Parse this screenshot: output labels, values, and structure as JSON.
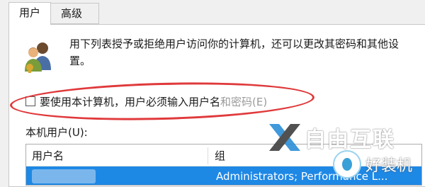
{
  "tabs": [
    {
      "label": "用户"
    },
    {
      "label": "高级"
    }
  ],
  "description": "用下列表授予或拒绝用户访问你的计算机，还可以更改其密码和其他设置。",
  "checkbox": {
    "label_main": "要使用本计算机，用户必须输入用户名",
    "label_tail": "和密码(E)",
    "checked": false
  },
  "list": {
    "label": "本机用户(U):",
    "columns": [
      "用户名",
      "组"
    ],
    "rows": [
      {
        "group": "Administrators; Performance L..."
      }
    ]
  },
  "colors": {
    "selection": "#1e88e5",
    "annotation": "#e0393b"
  },
  "watermarks": {
    "brand": "自由互联",
    "site": "好装机"
  }
}
